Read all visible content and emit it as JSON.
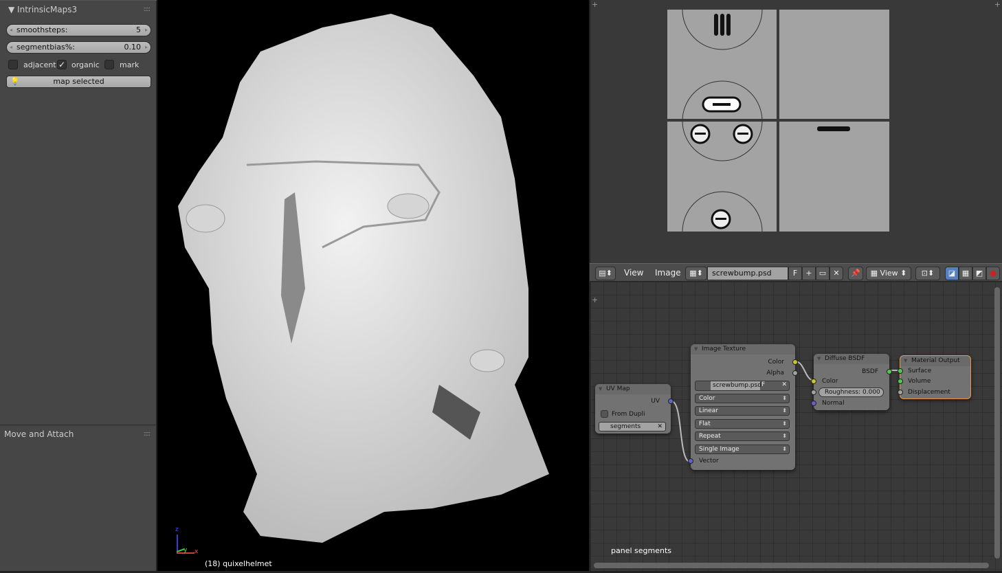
{
  "left_panel": {
    "title": "IntrinsicMaps3",
    "smoothsteps": {
      "label": "smoothsteps:",
      "value": "5"
    },
    "segmentbias": {
      "label": "segmentbias%:",
      "value": "0.10"
    },
    "checkboxes": [
      {
        "label": "adjacent",
        "checked": false
      },
      {
        "label": "organic",
        "checked": true
      },
      {
        "label": "mark",
        "checked": false
      }
    ],
    "map_button": "map selected",
    "operator_panel_title": "Move and Attach"
  },
  "viewport": {
    "object_label": "(18) quixelhelmet",
    "axis_labels": {
      "z": "z",
      "y": "y",
      "x": "x"
    }
  },
  "image_editor": {
    "menus": [
      "View",
      "Image"
    ],
    "image_name": "screwbump.psd",
    "fake_user": "F",
    "view_select": "View"
  },
  "node_editor": {
    "footer_label": "panel segments",
    "uv_map": {
      "title": "UV Map",
      "output": "UV",
      "from_dupli": "From Dupli",
      "uv_name": "segments"
    },
    "image_texture": {
      "title": "Image Texture",
      "outputs": [
        "Color",
        "Alpha"
      ],
      "image": "screwbump.psd",
      "fake_user": "F",
      "dropdowns": [
        "Color",
        "Linear",
        "Flat",
        "Repeat",
        "Single Image"
      ],
      "input": "Vector"
    },
    "diffuse": {
      "title": "Diffuse BSDF",
      "output": "BSDF",
      "inputs": [
        "Color",
        "Normal"
      ],
      "roughness_label": "Roughness:",
      "roughness": "0.000"
    },
    "output": {
      "title": "Material Output",
      "inputs": [
        "Surface",
        "Volume",
        "Displacement"
      ]
    }
  },
  "colors": {
    "socket_color": "#c7c729",
    "socket_shader": "#4fc94f",
    "socket_vector": "#6363c7",
    "socket_gray": "#a1a1a1",
    "active_node": "#e89a3c"
  }
}
